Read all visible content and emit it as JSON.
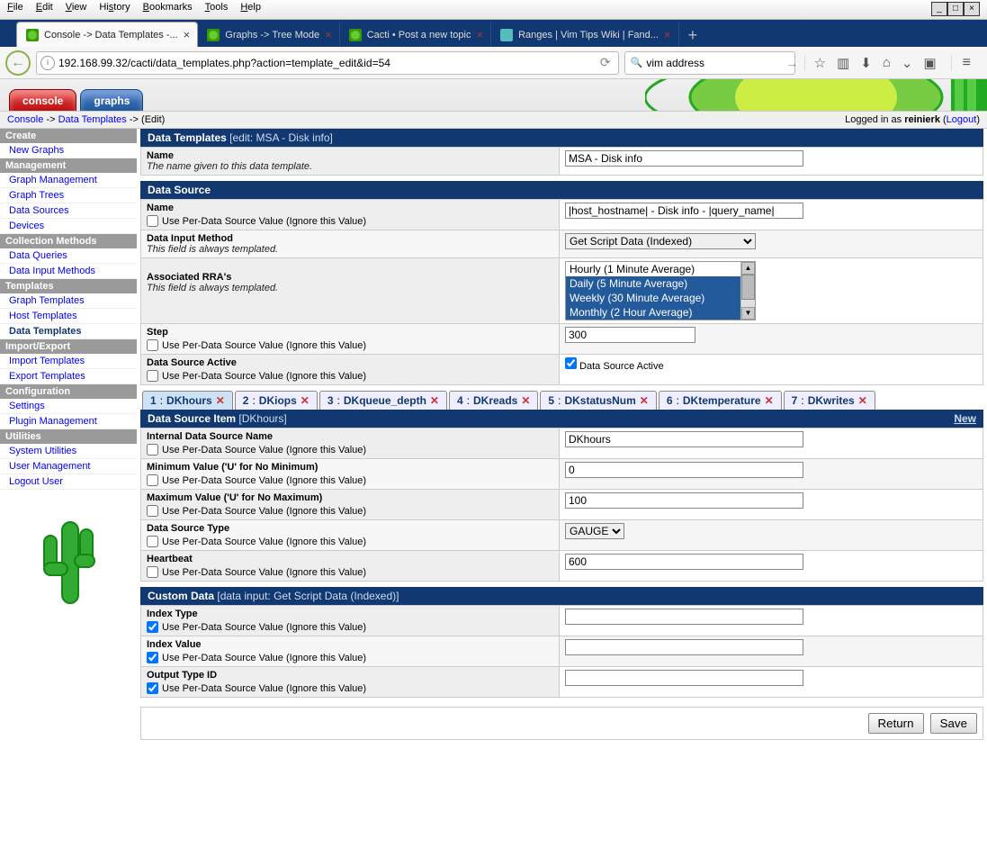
{
  "menubar": {
    "file": "File",
    "edit": "Edit",
    "view": "View",
    "history": "History",
    "bookmarks": "Bookmarks",
    "tools": "Tools",
    "help": "Help"
  },
  "btabs": [
    {
      "label": "Console -> Data Templates -..."
    },
    {
      "label": "Graphs -> Tree Mode"
    },
    {
      "label": "Cacti • Post a new topic"
    },
    {
      "label": "Ranges | Vim Tips Wiki | Fand..."
    }
  ],
  "url": "192.168.99.32/cacti/data_templates.php?action=template_edit&id=54",
  "search": "vim address",
  "cacti_tabs": {
    "console": "console",
    "graphs": "graphs"
  },
  "breadcrumb": {
    "a": "Console",
    "b": "Data Templates",
    "c": "(Edit)"
  },
  "login": {
    "pre": "Logged in as ",
    "user": "reinierk",
    "logout": "Logout"
  },
  "sidebar": {
    "create": "Create",
    "new_graphs": "New Graphs",
    "management": "Management",
    "graph_mgmt": "Graph Management",
    "graph_trees": "Graph Trees",
    "data_sources": "Data Sources",
    "devices": "Devices",
    "coll": "Collection Methods",
    "data_queries": "Data Queries",
    "data_input": "Data Input Methods",
    "templates": "Templates",
    "graph_tpl": "Graph Templates",
    "host_tpl": "Host Templates",
    "data_tpl": "Data Templates",
    "impexp": "Import/Export",
    "imp": "Import Templates",
    "exp": "Export Templates",
    "config": "Configuration",
    "settings": "Settings",
    "plugin": "Plugin Management",
    "util": "Utilities",
    "sysutil": "System Utilities",
    "usermgmt": "User Management",
    "logout": "Logout User"
  },
  "sections": {
    "dt": {
      "title": "Data Templates",
      "sub": "[edit: MSA - Disk info]"
    },
    "ds": {
      "title": "Data Source"
    },
    "dsi": {
      "title": "Data Source Item",
      "sub": "[DKhours]",
      "new": "New"
    },
    "cd": {
      "title": "Custom Data",
      "sub": "[data input: Get Script Data (Indexed)]"
    }
  },
  "labels": {
    "name": "Name",
    "name_desc": "The name given to this data template.",
    "perds": "Use Per-Data Source Value (Ignore this Value)",
    "dim": "Data Input Method",
    "always": "This field is always templated.",
    "rra": "Associated RRA's",
    "step": "Step",
    "dsactive_lbl": "Data Source Active",
    "dsactive_ck": "Data Source Active",
    "idsn": "Internal Data Source Name",
    "minv": "Minimum Value ('U' for No Minimum)",
    "maxv": "Maximum Value ('U' for No Maximum)",
    "dst": "Data Source Type",
    "hb": "Heartbeat",
    "idx_type": "Index Type",
    "idx_val": "Index Value",
    "otid": "Output Type ID"
  },
  "values": {
    "template_name": "MSA - Disk info",
    "ds_name": "|host_hostname| - Disk info - |query_name|",
    "dim_sel": "Get Script Data (Indexed)",
    "rra_opts": [
      "Hourly (1 Minute Average)",
      "Daily (5 Minute Average)",
      "Weekly (30 Minute Average)",
      "Monthly (2 Hour Average)"
    ],
    "step": "300",
    "idsn": "DKhours",
    "minv": "0",
    "maxv": "100",
    "dst": "GAUGE",
    "hb": "600",
    "idx_type": "",
    "idx_val": "",
    "otid": ""
  },
  "dsi_tabs": [
    {
      "n": "1",
      "name": "DKhours"
    },
    {
      "n": "2",
      "name": "DKiops"
    },
    {
      "n": "3",
      "name": "DKqueue_depth"
    },
    {
      "n": "4",
      "name": "DKreads"
    },
    {
      "n": "5",
      "name": "DKstatusNum"
    },
    {
      "n": "6",
      "name": "DKtemperature"
    },
    {
      "n": "7",
      "name": "DKwrites"
    }
  ],
  "buttons": {
    "return": "Return",
    "save": "Save"
  }
}
